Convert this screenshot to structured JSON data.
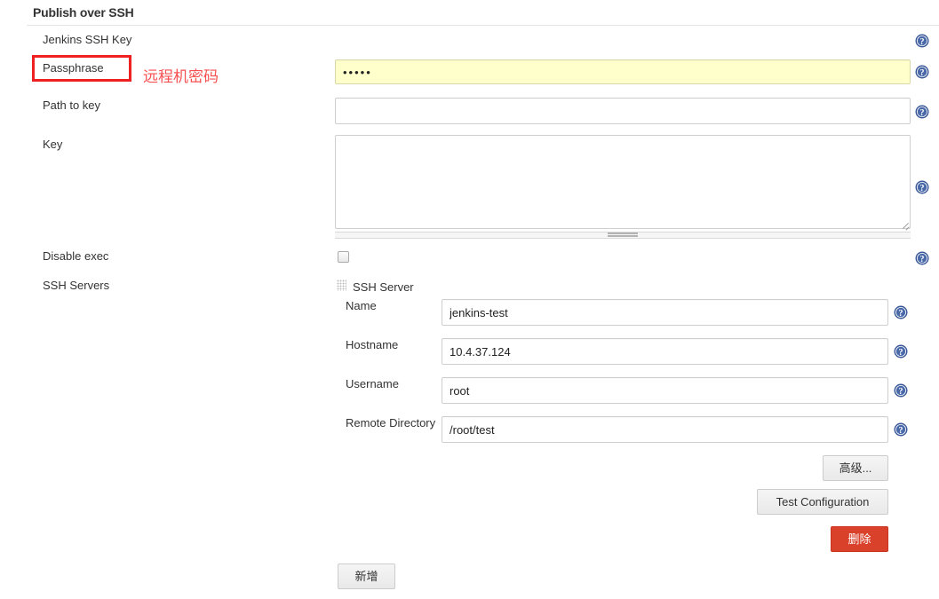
{
  "section": {
    "title": "Publish over SSH"
  },
  "fields": {
    "jenkins_ssh_key_label": "Jenkins SSH Key",
    "passphrase_label": "Passphrase",
    "passphrase_value": "•••••",
    "path_to_key_label": "Path to key",
    "path_to_key_value": "",
    "path_to_key_placeholder": "",
    "key_label": "Key",
    "key_value": "",
    "disable_exec_label": "Disable exec",
    "disable_exec_checked": false,
    "ssh_servers_label": "SSH Servers"
  },
  "ssh_server": {
    "heading": "SSH Server",
    "name_label": "Name",
    "name_value": "jenkins-test",
    "hostname_label": "Hostname",
    "hostname_value": "10.4.37.124",
    "username_label": "Username",
    "username_value": "root",
    "remote_directory_label": "Remote Directory",
    "remote_directory_value": "/root/test"
  },
  "buttons": {
    "advanced": "高级...",
    "test_configuration": "Test Configuration",
    "delete": "删除",
    "add": "新增"
  },
  "annotations": {
    "passphrase_note": "远程机密码",
    "box_color": "#f02020",
    "text_color": "#f85050"
  },
  "icons": {
    "help": "help-circle-icon",
    "drag": "drag-handle-icon"
  },
  "colors": {
    "secret_field_background": "#ffffcc",
    "delete_button": "#d9412b",
    "help_icon": "#3b5998"
  }
}
